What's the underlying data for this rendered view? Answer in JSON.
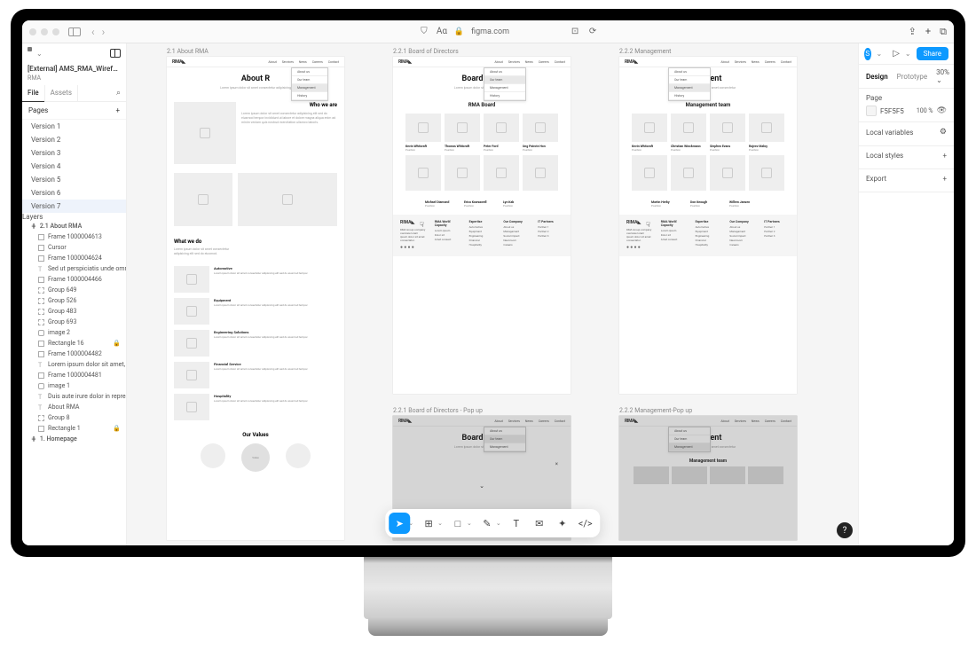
{
  "browser": {
    "url": "figma.com"
  },
  "file": {
    "name": "[External] AMS_RMA_Wiref…",
    "sub": "RMA"
  },
  "left_tabs": [
    "File",
    "Assets"
  ],
  "sections": {
    "pages": "Pages",
    "layers": "Layers"
  },
  "pages": [
    "Version 1",
    "Version 2",
    "Version 3",
    "Version 4",
    "Version 5",
    "Version 6",
    "Version 7"
  ],
  "selected_page": 6,
  "layer_root": "2.1 About RMA",
  "layers": [
    {
      "t": "Frame 1000004613",
      "i": "frame"
    },
    {
      "t": "Cursor",
      "i": "frame"
    },
    {
      "t": "Frame 1000004624",
      "i": "frame"
    },
    {
      "t": "Sed ut perspiciatis unde omnis ist",
      "i": "text"
    },
    {
      "t": "Frame 1000004466",
      "i": "frame"
    },
    {
      "t": "Group 649",
      "i": "group"
    },
    {
      "t": "Group 526",
      "i": "group"
    },
    {
      "t": "Group 483",
      "i": "group"
    },
    {
      "t": "Group 693",
      "i": "group"
    },
    {
      "t": "image 2",
      "i": "image"
    },
    {
      "t": "Rectangle 16",
      "i": "rect",
      "lock": true
    },
    {
      "t": "Frame 1000004482",
      "i": "frame"
    },
    {
      "t": "Lorem ipsum dolor sit amet, cons",
      "i": "text"
    },
    {
      "t": "Frame 1000004481",
      "i": "frame"
    },
    {
      "t": "image 1",
      "i": "image"
    },
    {
      "t": "Duis aute irure dolor in reprehend",
      "i": "text"
    },
    {
      "t": "About RMA",
      "i": "text"
    },
    {
      "t": "Group 8",
      "i": "group"
    },
    {
      "t": "Rectangle 1",
      "i": "rect",
      "lock": true
    }
  ],
  "layer_last": "1. Homepage",
  "artboards": {
    "a1": {
      "label": "2.1 About RMA",
      "title": "About R",
      "sub": "Lorem ipsum dolor sit amet consectetur adipisicing",
      "who": "Who we are",
      "what": "What we do",
      "values": "Our Values",
      "cats": [
        "Automotive",
        "Equipment",
        "Engineering Solutions",
        "Financial Service",
        "Hospitality"
      ]
    },
    "a2": {
      "label": "2.2.1 Board of Directors",
      "title": "Board of Di",
      "sub": "Lorem ipsum dolor sit amet consectetur",
      "team": "RMA Board"
    },
    "a3": {
      "label": "2.2.2 Management",
      "title": "gement",
      "sub": "Lorem ipsum dolor sit amet consectetur",
      "team": "Management team"
    },
    "a4": {
      "label": "2.2.1 Board of Directors - Pop up",
      "title": "Board of Di"
    },
    "a5": {
      "label": "2.2.2 Management-Pop up",
      "title": "gement",
      "team": "Management team"
    }
  },
  "people": {
    "board1": [
      {
        "n": "Kevin Whitcraft",
        "r": "Position"
      },
      {
        "n": "Thomas Whitcraft",
        "r": "Position"
      },
      {
        "n": "Peter Ford",
        "r": "Position"
      },
      {
        "n": "Ung Pairote Hon",
        "r": "Position"
      }
    ],
    "board2": [
      {
        "n": "Michael Diamond",
        "r": "Position"
      },
      {
        "n": "Erica Kowsawell",
        "r": "Position"
      },
      {
        "n": "Lyn Kak",
        "r": "Position"
      }
    ],
    "mgmt1": [
      {
        "n": "Kevin Whitcraft",
        "r": "Position"
      },
      {
        "n": "Christian Winckmann",
        "r": "Position"
      },
      {
        "n": "Stephen Evans",
        "r": "Position"
      },
      {
        "n": "Rajeev Maloy",
        "r": "Position"
      }
    ],
    "mgmt2": [
      {
        "n": "Martin Herby",
        "r": "Position"
      },
      {
        "n": "Don Keough",
        "r": "Position"
      },
      {
        "n": "Willem Jansen",
        "r": "Position"
      }
    ]
  },
  "footer": {
    "logo": "RIMA",
    "cols": [
      {
        "h": "RMA World Capacity",
        "items": [
          "Lorem ipsum",
          "Dolor sit",
          "Amet consect"
        ]
      },
      {
        "h": "Expertise",
        "items": [
          "Automotive",
          "Equipment",
          "Engineering",
          "Financial",
          "Hospitality"
        ]
      },
      {
        "h": "Our Company",
        "items": [
          "About us",
          "Management",
          "Social impact",
          "Newsroom",
          "Careers"
        ]
      },
      {
        "h": "IT Partners",
        "items": [
          "Partner 1",
          "Partner 2",
          "Partner 3"
        ]
      }
    ]
  },
  "right": {
    "tabs": [
      "Design",
      "Prototype"
    ],
    "zoom": "30%",
    "share": "Share",
    "page": "Page",
    "color": "F5F5F5",
    "opacity": "100",
    "pct_sym": "%",
    "locals": "Local variables",
    "styles": "Local styles",
    "export": "Export"
  },
  "toolbar_icons": [
    "move",
    "frame",
    "rect",
    "pen",
    "text",
    "comment",
    "actions",
    "dev"
  ]
}
